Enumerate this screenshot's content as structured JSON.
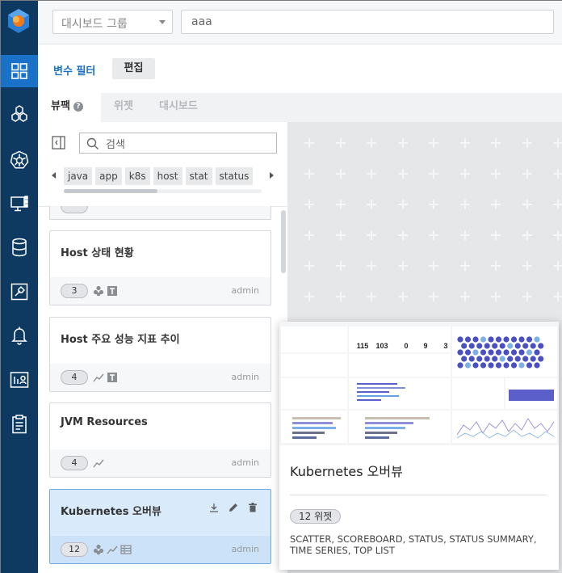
{
  "topbar": {
    "group_select_placeholder": "대시보드 그룹",
    "search_value": "aaa"
  },
  "filterbar": {
    "variable_filter_label": "변수 필터",
    "edit_label": "편집"
  },
  "tabs": [
    {
      "label": "뷰팩",
      "active": true
    },
    {
      "label": "위젯",
      "active": false
    },
    {
      "label": "대시보드",
      "active": false
    }
  ],
  "help_glyph": "?",
  "panel": {
    "search_placeholder": "검색",
    "tags": [
      "java",
      "app",
      "k8s",
      "host",
      "stat",
      "status"
    ]
  },
  "cards": [
    {
      "title": "Host 상태 현황",
      "count": "3",
      "icons": [
        "hexagon-cluster-icon",
        "text-box-icon"
      ],
      "author": "admin"
    },
    {
      "title": "Host 주요 성능 지표 추이",
      "count": "4",
      "icons": [
        "line-chart-icon",
        "text-box-icon"
      ],
      "author": "admin"
    },
    {
      "title": "JVM Resources",
      "count": "4",
      "icons": [
        "line-chart-icon"
      ],
      "author": "admin"
    },
    {
      "title": "Kubernetes 오버뷰",
      "count": "12",
      "icons": [
        "hexagon-cluster-icon",
        "line-chart-icon",
        "table-icon"
      ],
      "author": "admin",
      "selected": true
    }
  ],
  "preview": {
    "title": "Kubernetes 오버뷰",
    "widget_count_label": "12 위젯",
    "widget_types": "SCATTER, SCOREBOARD, STATUS, STATUS SUMMARY, TIME SERIES, TOP LIST",
    "thumbnail_stats": [
      "115",
      "103",
      "0",
      "9",
      "3"
    ]
  },
  "colors": {
    "rail": "#0e3a62",
    "accent": "#1a72c8",
    "selected_card": "#d9eafb"
  }
}
